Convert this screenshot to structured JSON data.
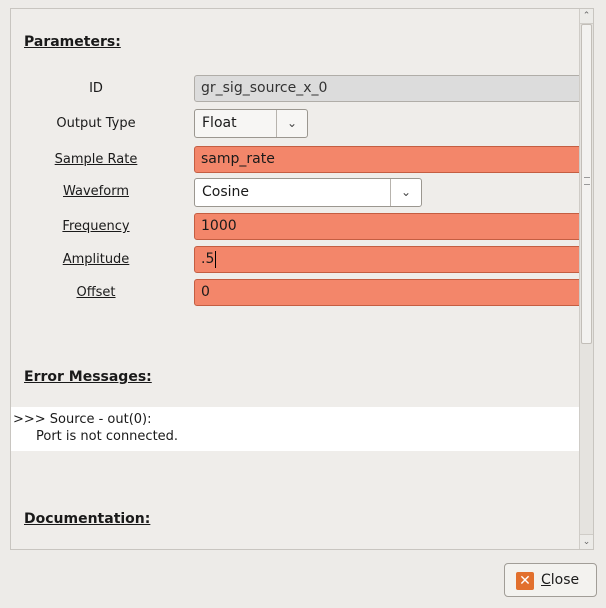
{
  "parameters": {
    "title": "Parameters:",
    "rows": [
      {
        "label": "ID",
        "value": "gr_sig_source_x_0"
      },
      {
        "label": "Output Type",
        "value": "Float"
      },
      {
        "label": "Sample Rate",
        "value": "samp_rate"
      },
      {
        "label": "Waveform",
        "value": "Cosine"
      },
      {
        "label": "Frequency",
        "value": "1000"
      },
      {
        "label": "Amplitude",
        "value": ".5"
      },
      {
        "label": "Offset",
        "value": "0"
      }
    ]
  },
  "errors": {
    "title": "Error Messages:",
    "line1": ">>> Source - out(0):",
    "line2": "Port is not connected."
  },
  "documentation": {
    "title": "Documentation:"
  },
  "footer": {
    "close_mnemonic": "C",
    "close_rest": "lose"
  },
  "colors": {
    "error_field": "#f3866a",
    "readonly_field": "#dcdcdc",
    "close_icon": "#e2702e"
  },
  "icons": {
    "dropdown": "chevron-down-icon",
    "close": "close-icon"
  }
}
